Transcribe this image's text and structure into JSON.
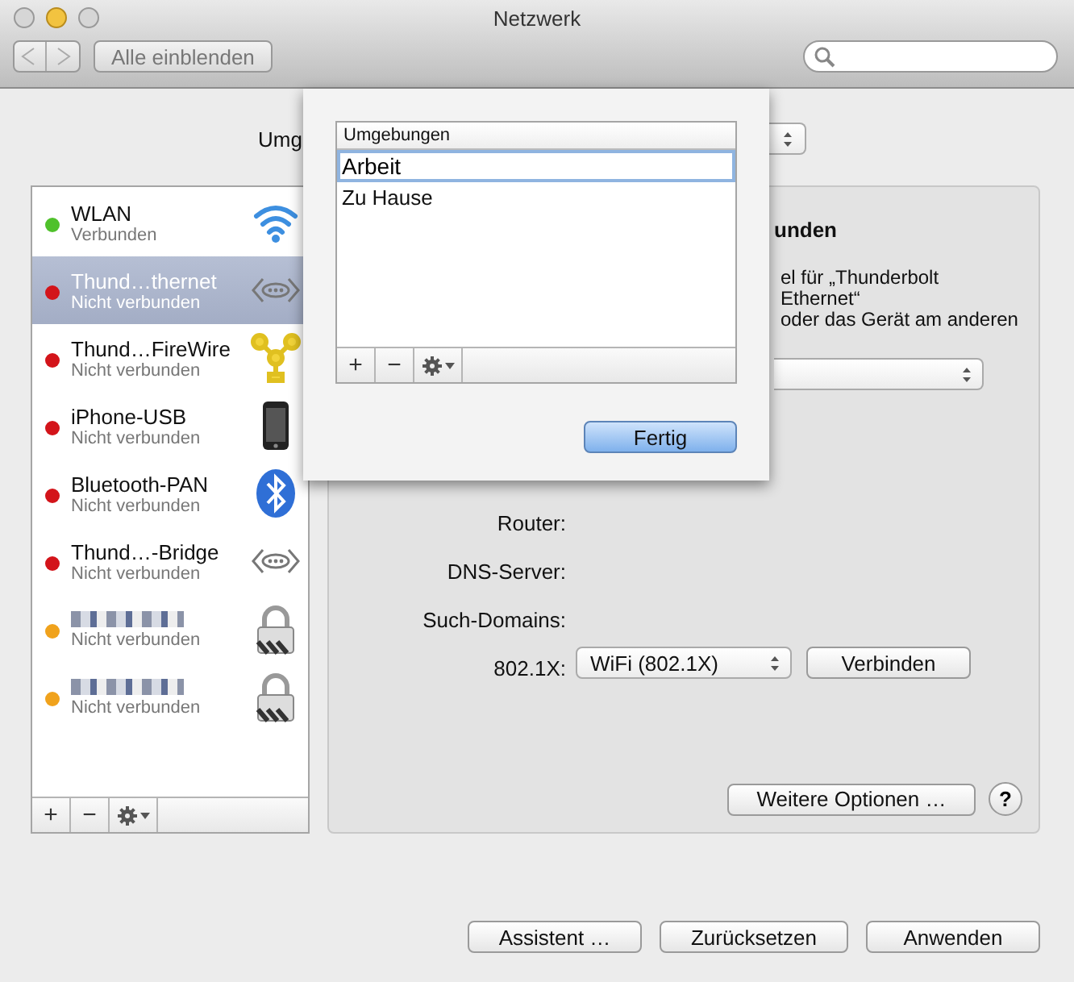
{
  "window": {
    "title": "Netzwerk"
  },
  "toolbar": {
    "show_all_button": "Alle einblenden"
  },
  "location": {
    "label": "Umg"
  },
  "services": [
    {
      "name": "WLAN",
      "status": "Verbunden",
      "color": "#4fc12b",
      "kind": "wifi",
      "selected": false
    },
    {
      "name": "Thund…thernet",
      "status": "Nicht verbunden",
      "color": "#d3141a",
      "kind": "ethernet",
      "selected": true
    },
    {
      "name": "Thund…FireWire",
      "status": "Nicht verbunden",
      "color": "#d3141a",
      "kind": "firewire",
      "selected": false
    },
    {
      "name": "iPhone-USB",
      "status": "Nicht verbunden",
      "color": "#d3141a",
      "kind": "phone",
      "selected": false
    },
    {
      "name": "Bluetooth-PAN",
      "status": "Nicht verbunden",
      "color": "#d3141a",
      "kind": "bluetooth",
      "selected": false
    },
    {
      "name": "Thund…-Bridge",
      "status": "Nicht verbunden",
      "color": "#d3141a",
      "kind": "ethernet",
      "selected": false
    },
    {
      "status": "Nicht verbunden",
      "color": "#f0a21c",
      "kind": "lock",
      "selected": false
    },
    {
      "status": "Nicht verbunden",
      "color": "#f0a21c",
      "kind": "lock",
      "selected": false
    }
  ],
  "service_toolbar": {
    "add": "+",
    "remove": "−"
  },
  "detail": {
    "heading": "unden",
    "description": [
      "el für „Thunderbolt Ethernet“",
      "oder das Gerät am anderen"
    ],
    "fields": [
      {
        "label": "Router:"
      },
      {
        "label": "DNS-Server:"
      },
      {
        "label": "Such-Domains:"
      },
      {
        "label": "802.1X:",
        "popup": "WiFi (802.1X)",
        "button": "Verbinden"
      }
    ],
    "more_button": "Weitere Optionen …",
    "help": "?"
  },
  "sheet": {
    "column": "Umgebungen",
    "rows": [
      {
        "name": "Arbeit",
        "editing": true
      },
      {
        "name": "Zu Hause",
        "editing": false
      }
    ],
    "add": "+",
    "remove": "−",
    "done_button": "Fertig"
  },
  "buttons": [
    "Assistent …",
    "Zurücksetzen",
    "Anwenden"
  ]
}
